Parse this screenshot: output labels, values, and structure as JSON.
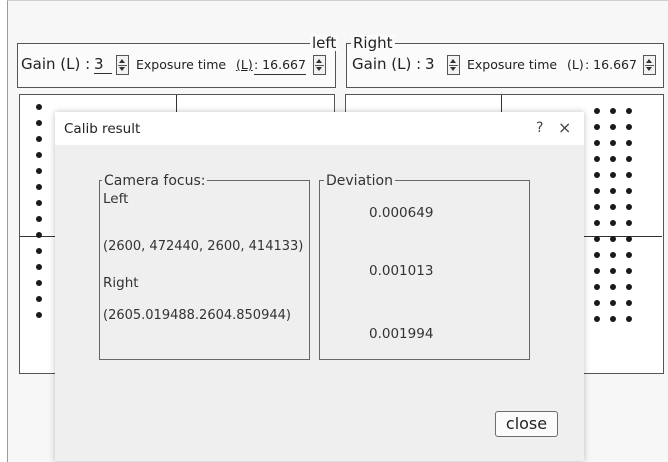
{
  "left_panel": {
    "title": "left",
    "gain_label": "Gain (L) :",
    "gain_value": "3",
    "exposure_label": "Exposure time",
    "exposure_unit": "(L)",
    "exposure_value": ": 16.667"
  },
  "right_panel": {
    "title": "Right",
    "gain_label": "Gain (L) :",
    "gain_value": "3",
    "exposure_label": "Exposure time",
    "exposure_unit": "(L)",
    "exposure_value": ": 16.667"
  },
  "dialog": {
    "title": "Calib result",
    "help": "?",
    "close_x": "×",
    "focus_group": {
      "title": "Camera focus:",
      "left_label": "Left",
      "left_value": "(2600, 472440, 2600, 414133)",
      "right_label": "Right",
      "right_value": "(2605.019488.2604.850944)"
    },
    "deviation_group": {
      "title": "Deviation",
      "values": [
        "0.000649",
        "0.001013",
        "0.001994"
      ]
    },
    "close_button": "close"
  }
}
